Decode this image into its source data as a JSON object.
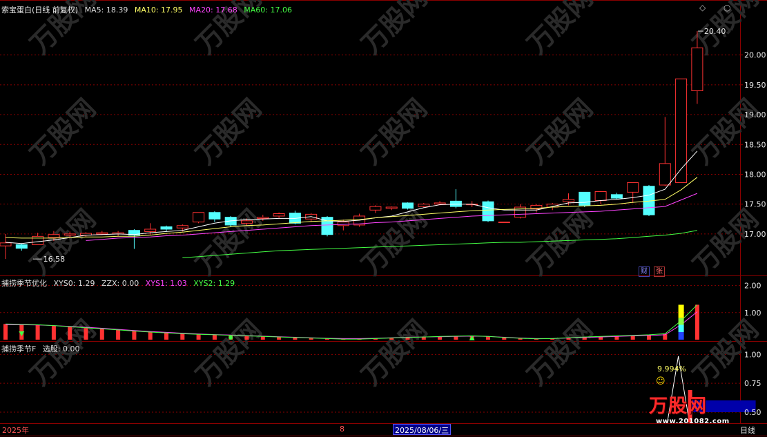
{
  "main": {
    "stock_name": "索宝蛋白",
    "period": "(日线 前复权)",
    "ma": [
      {
        "label": "MA5:",
        "value": "18.39",
        "color": "#ffffff"
      },
      {
        "label": "MA10:",
        "value": "17.95",
        "color": "#ffff66"
      },
      {
        "label": "MA20:",
        "value": "17.68",
        "color": "#ff44ff"
      },
      {
        "label": "MA60:",
        "value": "17.06",
        "color": "#44ff44"
      }
    ],
    "high_label": "20.40",
    "low_label": "16.58",
    "badges": {
      "cai": "财",
      "zhang": "张"
    }
  },
  "panel2": {
    "name": "捕捞季节优化",
    "items": [
      {
        "label": "XYS0:",
        "value": "1.29",
        "color": "#e8e8e8"
      },
      {
        "label": "ZZX:",
        "value": "0.00",
        "color": "#e8e8e8"
      },
      {
        "label": "XYS1:",
        "value": "1.03",
        "color": "#ff44ff"
      },
      {
        "label": "XYS2:",
        "value": "1.29",
        "color": "#44ff44"
      }
    ]
  },
  "panel3": {
    "name": "捕捞季节F",
    "items": [
      {
        "label": "选股:",
        "value": "0.00",
        "color": "#e8e8e8"
      }
    ],
    "annotation": "9.994%"
  },
  "footer": {
    "year": "2025年",
    "month": "8",
    "date": "2025/08/06/三",
    "period": "日线"
  },
  "watermark": {
    "brand": "万股网",
    "url": "www.201082.com"
  },
  "colors": {
    "up": "#ff3232",
    "down": "#54ffff",
    "grid": "#8b0000",
    "background": "#000000"
  },
  "chart_data": [
    {
      "type": "candlestick",
      "y_ticks": [
        "20.00",
        "19.50",
        "19.00",
        "18.50",
        "18.00",
        "17.50",
        "17.00"
      ],
      "ylim": [
        16.42,
        20.69
      ],
      "candles": [
        [
          16.8,
          16.85,
          16.58,
          17.0
        ],
        [
          16.82,
          16.76,
          16.72,
          16.84
        ],
        [
          16.82,
          16.96,
          16.82,
          17.02
        ],
        [
          16.94,
          16.99,
          16.88,
          17.05
        ],
        [
          16.98,
          17.0,
          16.94,
          17.04
        ],
        [
          16.98,
          17.01,
          16.95,
          17.03
        ],
        [
          17.0,
          17.02,
          16.98,
          17.05
        ],
        [
          17.0,
          17.02,
          16.96,
          17.05
        ],
        [
          17.06,
          16.98,
          16.75,
          17.08
        ],
        [
          17.04,
          17.08,
          16.98,
          17.18
        ],
        [
          17.12,
          17.08,
          17.04,
          17.14
        ],
        [
          17.1,
          17.14,
          17.04,
          17.16
        ],
        [
          17.2,
          17.36,
          17.18,
          17.36
        ],
        [
          17.36,
          17.25,
          17.2,
          17.38
        ],
        [
          17.28,
          17.15,
          17.12,
          17.3
        ],
        [
          17.18,
          17.22,
          17.14,
          17.26
        ],
        [
          17.26,
          17.28,
          17.22,
          17.32
        ],
        [
          17.3,
          17.34,
          17.26,
          17.36
        ],
        [
          17.35,
          17.18,
          17.16,
          17.39
        ],
        [
          17.25,
          17.33,
          17.2,
          17.35
        ],
        [
          17.28,
          16.99,
          16.96,
          17.3
        ],
        [
          17.14,
          17.2,
          17.06,
          17.24
        ],
        [
          17.15,
          17.3,
          17.12,
          17.34
        ],
        [
          17.4,
          17.46,
          17.35,
          17.48
        ],
        [
          17.43,
          17.45,
          17.4,
          17.46
        ],
        [
          17.52,
          17.43,
          17.41,
          17.53
        ],
        [
          17.46,
          17.5,
          17.44,
          17.52
        ],
        [
          17.5,
          17.52,
          17.48,
          17.55
        ],
        [
          17.55,
          17.46,
          17.43,
          17.75
        ],
        [
          17.5,
          17.5,
          17.45,
          17.55
        ],
        [
          17.54,
          17.22,
          17.2,
          17.56
        ],
        [
          17.2,
          17.2,
          17.2,
          17.2
        ],
        [
          17.28,
          17.45,
          17.26,
          17.5
        ],
        [
          17.42,
          17.48,
          17.36,
          17.5
        ],
        [
          17.45,
          17.5,
          17.4,
          17.52
        ],
        [
          17.54,
          17.58,
          17.48,
          17.68
        ],
        [
          17.7,
          17.48,
          17.45,
          17.7
        ],
        [
          17.56,
          17.71,
          17.5,
          17.72
        ],
        [
          17.66,
          17.6,
          17.58,
          17.69
        ],
        [
          17.7,
          17.86,
          17.52,
          17.86
        ],
        [
          17.8,
          17.32,
          17.3,
          17.82
        ],
        [
          17.82,
          18.18,
          17.8,
          18.96
        ],
        [
          17.86,
          19.6,
          17.86,
          19.6
        ],
        [
          19.4,
          20.12,
          19.18,
          20.4
        ]
      ],
      "ma5": [
        16.86,
        16.84,
        16.87,
        16.9,
        16.94,
        16.98,
        16.99,
        17.0,
        16.99,
        17.02,
        17.04,
        17.06,
        17.12,
        17.18,
        17.22,
        17.24,
        17.25,
        17.26,
        17.26,
        17.29,
        17.22,
        17.21,
        17.23,
        17.27,
        17.3,
        17.37,
        17.44,
        17.49,
        17.5,
        17.5,
        17.44,
        17.4,
        17.4,
        17.4,
        17.46,
        17.52,
        17.53,
        17.56,
        17.58,
        17.61,
        17.65,
        17.75,
        18.09,
        18.39
      ],
      "ma10": [
        16.94,
        16.93,
        16.93,
        16.93,
        16.94,
        16.95,
        16.95,
        16.96,
        16.96,
        16.98,
        17.01,
        17.03,
        17.06,
        17.09,
        17.12,
        17.14,
        17.15,
        17.17,
        17.19,
        17.21,
        17.22,
        17.23,
        17.24,
        17.27,
        17.29,
        17.31,
        17.33,
        17.35,
        17.37,
        17.39,
        17.4,
        17.41,
        17.42,
        17.43,
        17.45,
        17.46,
        17.47,
        17.48,
        17.5,
        17.53,
        17.55,
        17.58,
        17.74,
        17.95
      ],
      "ma20": [
        null,
        null,
        null,
        null,
        null,
        16.89,
        16.91,
        16.93,
        16.94,
        16.95,
        16.97,
        16.98,
        17.0,
        17.02,
        17.04,
        17.06,
        17.08,
        17.1,
        17.12,
        17.14,
        17.15,
        17.16,
        17.17,
        17.19,
        17.2,
        17.22,
        17.24,
        17.26,
        17.28,
        17.3,
        17.31,
        17.32,
        17.33,
        17.34,
        17.35,
        17.36,
        17.37,
        17.38,
        17.4,
        17.42,
        17.44,
        17.46,
        17.57,
        17.68
      ],
      "ma60": [
        null,
        null,
        null,
        null,
        null,
        null,
        null,
        null,
        null,
        null,
        null,
        16.6,
        16.62,
        16.64,
        16.66,
        16.68,
        16.7,
        16.72,
        16.73,
        16.74,
        16.75,
        16.76,
        16.77,
        16.78,
        16.79,
        16.8,
        16.81,
        16.82,
        16.83,
        16.84,
        16.85,
        16.86,
        16.86,
        16.87,
        16.88,
        16.89,
        16.9,
        16.91,
        16.92,
        16.94,
        16.96,
        16.98,
        17.01,
        17.06
      ]
    },
    {
      "type": "bar",
      "name": "捕捞季节优化",
      "y_ticks": [
        "2.00",
        "1.00"
      ],
      "ylim": [
        0,
        2.22
      ],
      "values": [
        0.58,
        0.57,
        0.55,
        0.52,
        0.48,
        0.44,
        0.4,
        0.36,
        0.32,
        0.28,
        0.25,
        0.22,
        0.2,
        0.18,
        0.16,
        0.14,
        0.12,
        0.1,
        0.08,
        0.06,
        0.04,
        0.02,
        0.02,
        0.04,
        0.06,
        0.08,
        0.1,
        0.12,
        0.13,
        0.14,
        0.12,
        0.08,
        0.05,
        0.03,
        0.04,
        0.07,
        0.1,
        0.12,
        0.14,
        0.16,
        0.18,
        0.22,
        0.7,
        1.29
      ],
      "xys1": [
        0.55,
        0.55,
        0.54,
        0.52,
        0.49,
        0.46,
        0.42,
        0.38,
        0.34,
        0.3,
        0.27,
        0.24,
        0.21,
        0.19,
        0.17,
        0.15,
        0.13,
        0.11,
        0.09,
        0.07,
        0.05,
        0.04,
        0.04,
        0.05,
        0.07,
        0.09,
        0.1,
        0.11,
        0.12,
        0.13,
        0.12,
        0.09,
        0.06,
        0.04,
        0.04,
        0.06,
        0.08,
        0.1,
        0.12,
        0.14,
        0.15,
        0.18,
        0.55,
        1.03
      ],
      "xys2": [
        0.58,
        0.57,
        0.55,
        0.52,
        0.48,
        0.44,
        0.4,
        0.36,
        0.32,
        0.28,
        0.25,
        0.22,
        0.2,
        0.18,
        0.16,
        0.14,
        0.12,
        0.1,
        0.08,
        0.06,
        0.04,
        0.02,
        0.02,
        0.04,
        0.06,
        0.08,
        0.1,
        0.12,
        0.13,
        0.14,
        0.12,
        0.08,
        0.05,
        0.03,
        0.04,
        0.07,
        0.1,
        0.12,
        0.14,
        0.16,
        0.18,
        0.22,
        0.7,
        1.29
      ]
    },
    {
      "type": "line",
      "name": "捕捞季节F",
      "y_ticks": [
        "1.00",
        "0.75",
        "0.50"
      ],
      "ylim": [
        0.41,
        1.08
      ]
    }
  ]
}
